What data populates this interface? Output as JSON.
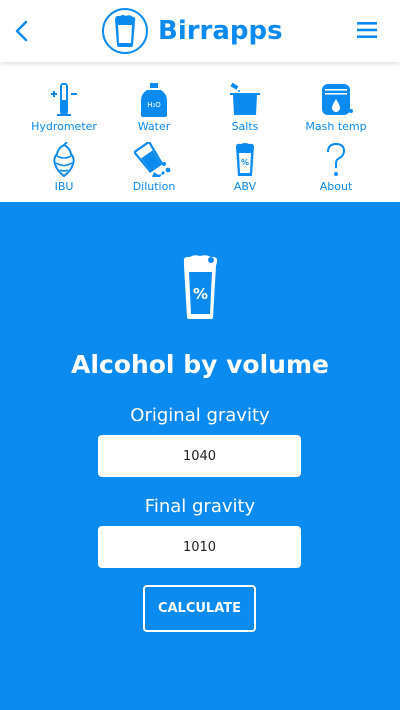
{
  "app": {
    "title": "Birrapps"
  },
  "colors": {
    "accent": "#0b8af0",
    "surface": "#ffffff"
  },
  "header": {
    "back_icon": "chevron-left-icon",
    "logo_icon": "beer-glass-icon",
    "menu_icon": "hamburger-menu-icon"
  },
  "tools": [
    {
      "label": "Hydrometer",
      "icon": "hydrometer-icon"
    },
    {
      "label": "Water",
      "icon": "water-jug-icon"
    },
    {
      "label": "Salts",
      "icon": "salts-pot-icon"
    },
    {
      "label": "Mash temp",
      "icon": "mash-tun-icon"
    },
    {
      "label": "IBU",
      "icon": "hop-icon"
    },
    {
      "label": "Dilution",
      "icon": "dilution-pour-icon"
    },
    {
      "label": "ABV",
      "icon": "abv-glass-icon"
    },
    {
      "label": "About",
      "icon": "question-mark-icon"
    }
  ],
  "main": {
    "title": "Alcohol by volume",
    "hero_icon": "beer-glass-percent-icon",
    "og_label": "Original gravity",
    "og_value": "1040",
    "fg_label": "Final gravity",
    "fg_value": "1010",
    "button_label": "CALCULATE"
  }
}
